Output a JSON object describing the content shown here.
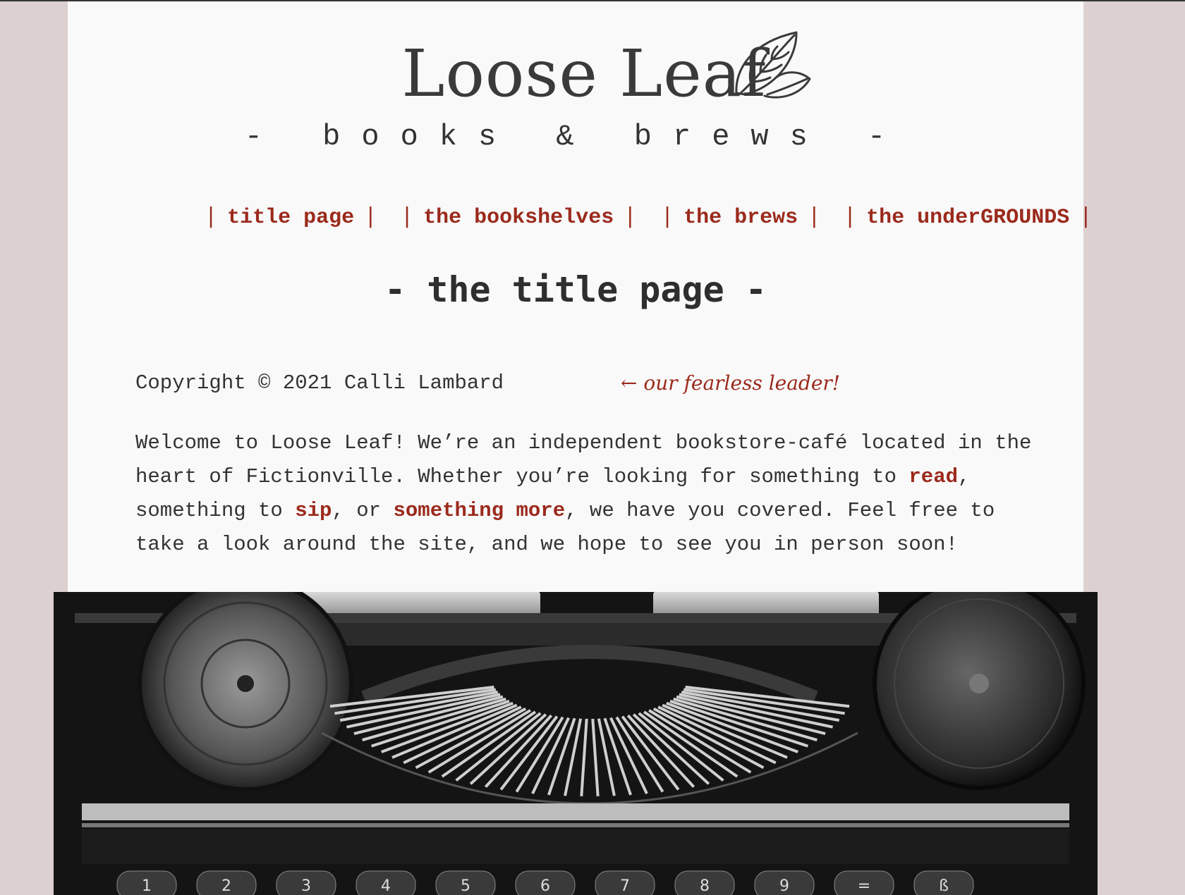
{
  "header": {
    "title": "Loose Leaf",
    "tagline": "- books & brews -",
    "logo_icon": "leaf-icon"
  },
  "nav": {
    "items": [
      {
        "label": "title page"
      },
      {
        "label": "the bookshelves"
      },
      {
        "label": "the brews"
      },
      {
        "label": "the underGROUNDS"
      }
    ],
    "bar": "|"
  },
  "main": {
    "section_title": "- the title page -",
    "copyright": "Copyright © 2021 Calli Lambard",
    "fearless_note": "← our fearless leader!",
    "intro": {
      "p1": "Welcome to Loose Leaf! We’re an independent bookstore-café located in the heart of Fictionville. Whether you’re looking for something to ",
      "link_read": "read",
      "p2": ", something to ",
      "link_sip": "sip",
      "p3": ", or ",
      "link_more": "something more",
      "p4": ", we have you covered. Feel free to take a look around the site, and we hope to see you in person soon!"
    }
  },
  "colors": {
    "background": "#ddd0d0",
    "page": "#f9f9f9",
    "accent": "#9b2a1c",
    "text": "#333333"
  },
  "typewriter": {
    "key_labels": [
      "1",
      "2",
      "3",
      "4",
      "5",
      "6",
      "7",
      "8",
      "9",
      "=",
      "ß"
    ]
  }
}
